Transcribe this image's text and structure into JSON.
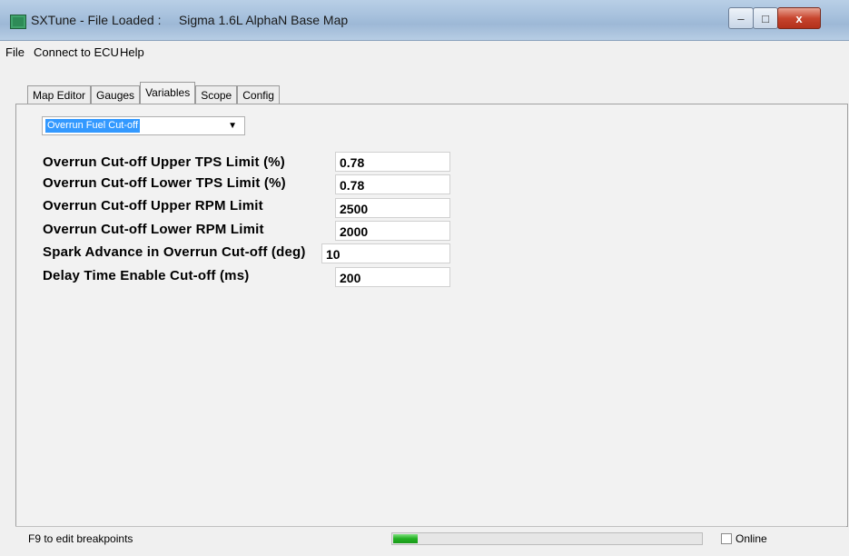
{
  "window": {
    "title": "SXTune - File Loaded :     Sigma 1.6L AlphaN Base Map",
    "controls": {
      "minimize": "–",
      "maximize": "□",
      "close": "x"
    }
  },
  "menu": [
    "File",
    "Connect to ECU",
    "Help"
  ],
  "tabs": [
    "Map Editor",
    "Gauges",
    "Variables",
    "Scope",
    "Config"
  ],
  "active_tab": "Variables",
  "dropdown": {
    "selected": "Overrun Fuel Cut-off",
    "arrow": "▼"
  },
  "variables": [
    {
      "label": "Overrun Cut-off Upper TPS Limit (%)",
      "value": "0.78"
    },
    {
      "label": "Overrun Cut-off Lower TPS Limit (%)",
      "value": "0.78"
    },
    {
      "label": "Overrun Cut-off Upper RPM Limit",
      "value": "2500"
    },
    {
      "label": "Overrun Cut-off Lower RPM Limit",
      "value": "2000"
    },
    {
      "label": "Spark Advance in Overrun Cut-off (deg)",
      "value": "10"
    },
    {
      "label": "Delay Time Enable Cut-off (ms)",
      "value": "200"
    }
  ],
  "status": {
    "text": "F9 to edit breakpoints",
    "progress": 0.08,
    "online_label": "Online",
    "online_checked": false
  }
}
